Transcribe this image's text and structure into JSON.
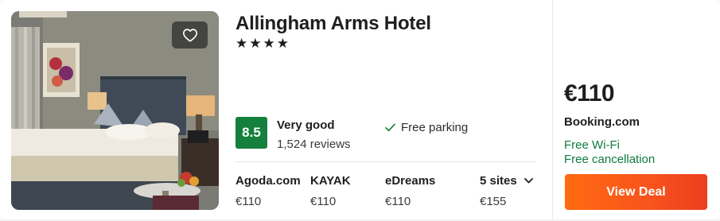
{
  "hotel": {
    "name": "Allingham Arms Hotel",
    "stars": "★★★★",
    "star_count": 4,
    "photo_icon": "hotel-room-photo",
    "favorite_icon": "heart-outline-icon"
  },
  "rating": {
    "score": "8.5",
    "label": "Very good",
    "reviews": "1,524 reviews",
    "badge_color": "#15803d"
  },
  "amenity": {
    "label": "Free parking",
    "icon": "check-icon"
  },
  "providers": [
    {
      "name": "Agoda.com",
      "price": "€110"
    },
    {
      "name": "KAYAK",
      "price": "€110"
    },
    {
      "name": "eDreams",
      "price": "€110"
    },
    {
      "name": "5 sites",
      "price": "€155",
      "icon": "chevron-down-icon"
    }
  ],
  "deal": {
    "price": "€110",
    "site": "Booking.com",
    "perks": [
      "Free Wi-Fi",
      "Free cancellation"
    ],
    "button_label": "View Deal",
    "perk_color": "#0f7a3e",
    "button_color": "#f8531d"
  }
}
